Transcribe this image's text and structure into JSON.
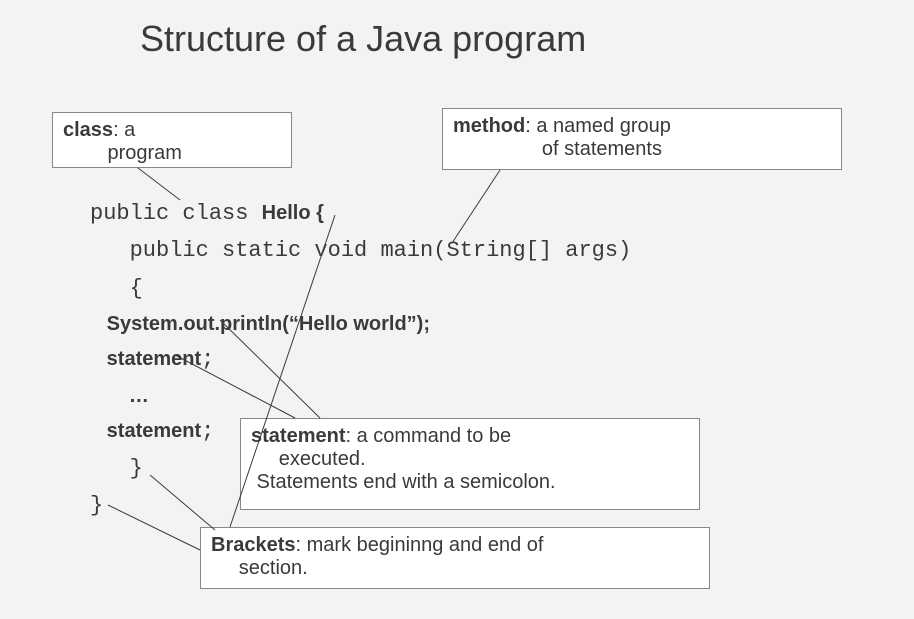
{
  "title": "Structure of a Java program",
  "callouts": {
    "class": {
      "label": "class",
      "text": ": a\n        program"
    },
    "method": {
      "label": "method",
      "text": ": a named group\n                of statements"
    },
    "statement": {
      "label": "statement",
      "text": ": a command to be\n     executed.\n Statements end with a semicolon."
    },
    "brackets": {
      "label": "Brackets",
      "text": ": mark begininng and end of\n     section."
    }
  },
  "code": {
    "l1a": "public class ",
    "l1b": "Hello {",
    "l2": "   public static void main(String[] args)",
    "l3": "   {",
    "l4": "   System.out.println(“Hello world”);",
    "l5": "   statement",
    "l5b": ";",
    "l6": "       …",
    "l7": "   statement",
    "l7b": ";",
    "l8": "   }",
    "l9": "}"
  }
}
